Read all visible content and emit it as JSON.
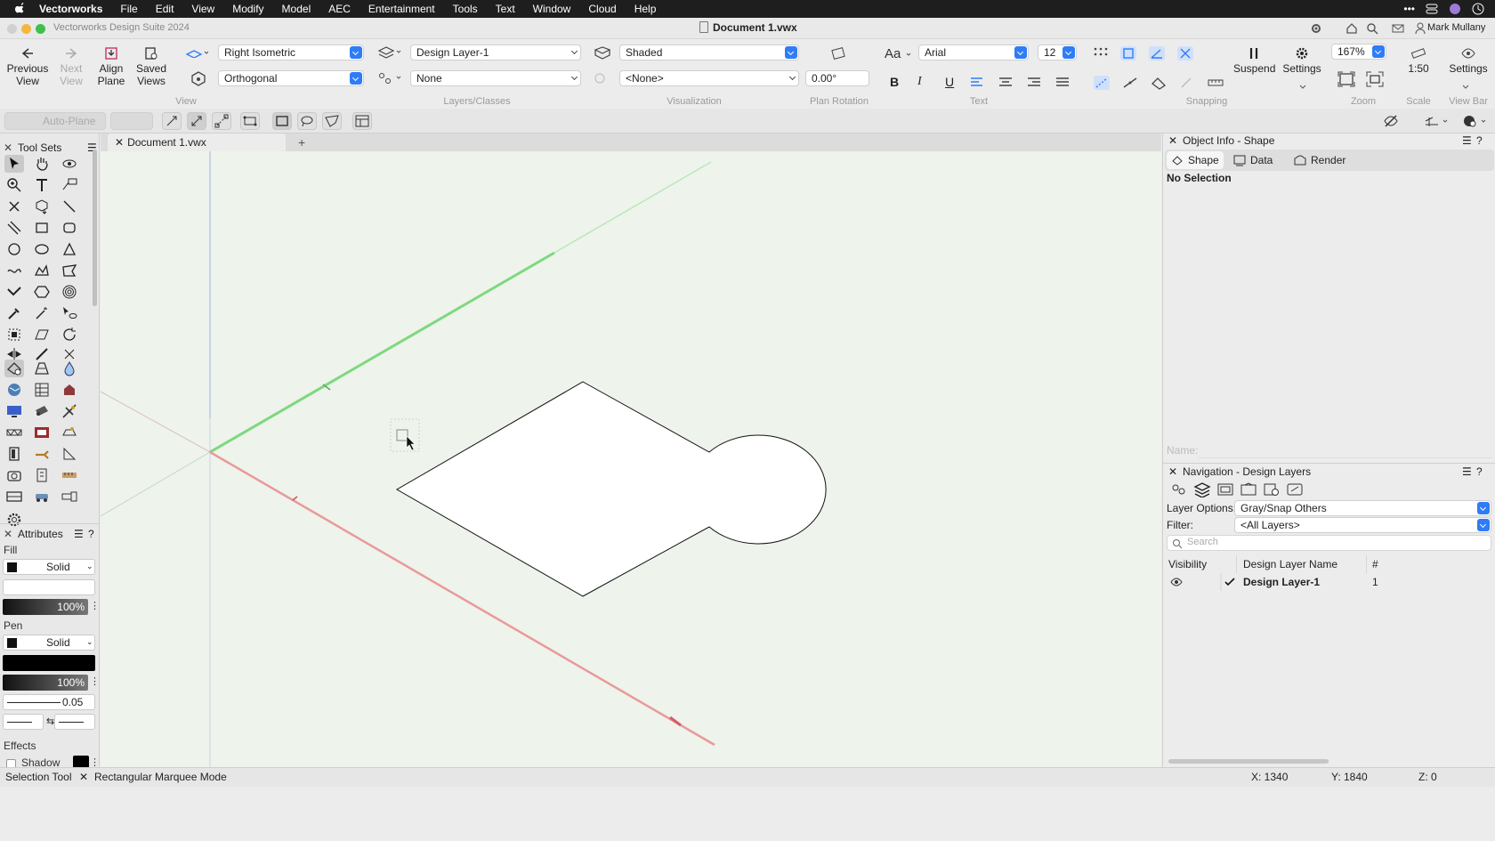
{
  "menubar": {
    "app": "Vectorworks",
    "items": [
      "File",
      "Edit",
      "View",
      "Modify",
      "Model",
      "AEC",
      "Entertainment",
      "Tools",
      "Text",
      "Window",
      "Cloud",
      "Help"
    ]
  },
  "window": {
    "app_title": "Vectorworks Design Suite 2024",
    "doc_title": "Document 1.vwx",
    "user": "Mark Mullany"
  },
  "toolbar": {
    "previous_view": "Previous\nView",
    "next_view": "Next\nView",
    "align_plane": "Align\nPlane",
    "saved_views": "Saved\nViews",
    "view_select": "Right Isometric",
    "projection_select": "Orthogonal",
    "layer_select": "Design Layer-1",
    "class_select": "None",
    "render_select": "Shaded",
    "light_select": "<None>",
    "plan_rotation": "0.00°",
    "font_select": "Arial",
    "font_size": "12",
    "suspend": "Suspend",
    "settings": "Settings",
    "zoom": "167%",
    "scale": "1:50",
    "viewbar_settings": "Settings",
    "groups": {
      "view": "View",
      "layers_classes": "Layers/Classes",
      "visualization": "Visualization",
      "plan_rotation": "Plan Rotation",
      "text": "Text",
      "snapping": "Snapping",
      "zoom": "Zoom",
      "scale": "Scale",
      "view_bar": "View Bar"
    }
  },
  "modebar": {
    "auto_plane": "Auto-Plane"
  },
  "tool_sets": {
    "title": "Tool Sets"
  },
  "attributes": {
    "title": "Attributes",
    "fill_label": "Fill",
    "fill_style": "Solid",
    "fill_opacity": "100%",
    "pen_label": "Pen",
    "pen_style": "Solid",
    "pen_opacity": "100%",
    "line_weight": "0.05",
    "effects_label": "Effects",
    "shadow_label": "Shadow"
  },
  "document_tab": {
    "name": "Document 1.vwx"
  },
  "object_info": {
    "title": "Object Info - Shape",
    "tabs": [
      "Shape",
      "Data",
      "Render"
    ],
    "status": "No Selection",
    "name_label": "Name:"
  },
  "navigation": {
    "title": "Navigation - Design Layers",
    "layer_options_label": "Layer Options:",
    "layer_options_value": "Gray/Snap Others",
    "filter_label": "Filter:",
    "filter_value": "<All Layers>",
    "search_placeholder": "Search",
    "columns": [
      "Visibility",
      "Design Layer Name",
      "#"
    ],
    "rows": [
      {
        "name": "Design Layer-1",
        "number": "1"
      }
    ]
  },
  "statusbar": {
    "tool": "Selection Tool",
    "mode": "Rectangular Marquee Mode",
    "x": "X: 1340",
    "y": "Y: 1840",
    "z": "Z: 0"
  },
  "colors": {
    "canvas": "#eef3ec",
    "accent": "#2f7cf6",
    "x_axis": "#e07a7a",
    "y_axis": "#7ed87e"
  }
}
